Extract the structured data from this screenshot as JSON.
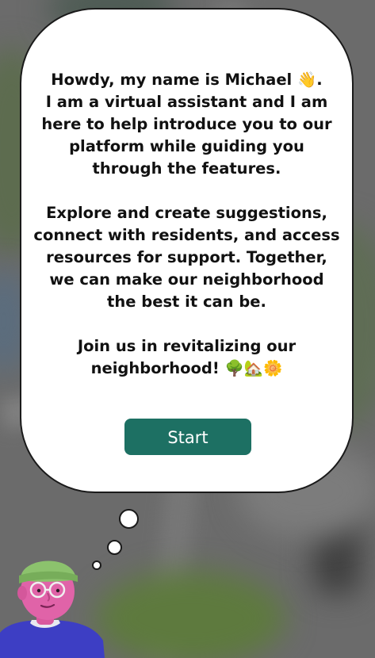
{
  "assistant": {
    "message": "Howdy, my name is Michael 👋.\nI am a virtual assistant and I am here to help introduce you to our platform while guiding you through the features.\n\nExplore and create suggestions, connect with residents, and access resources for support. Together, we can make our neighborhood the best it can be.\n\nJoin us in revitalizing our neighborhood! 🌳🏡🌼",
    "start_label": "Start"
  },
  "colors": {
    "button": "#1d7063",
    "bubble": "#ffffff",
    "background": "#6b6b6b"
  },
  "icons": [
    "map-background",
    "avatar-character"
  ]
}
